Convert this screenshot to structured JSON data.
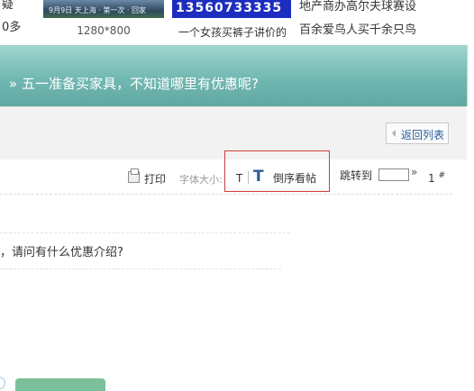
{
  "top": {
    "left_lines": [
      "疑",
      "0多"
    ],
    "thumb1": {
      "caption_overlay": "9月9日 天上海 · 第一次 · 回家",
      "caption": "1280*800"
    },
    "thumb2": {
      "number": "13560733335",
      "caption": "一个女孩买裤子讲价的"
    },
    "news": [
      "地产商办高尔夫球赛设",
      "百余爱鸟人买千余只鸟"
    ]
  },
  "thread": {
    "title": "» 五一准备买家具，不知道哪里有优惠呢?"
  },
  "actions": {
    "back_to_list": "返回列表"
  },
  "toolbar": {
    "print": "打印",
    "font_size_label": "字体大小:",
    "font_small": "T",
    "font_large": "T",
    "reverse_view": "倒序看帖",
    "jump_to": "跳转到",
    "jump_go": "»",
    "floor": "1",
    "floor_suffix": "#"
  },
  "post": {
    "text": "，请问有什么优惠介绍?"
  },
  "colors": {
    "banner": "#72b8b2",
    "link": "#2b5d9c",
    "highlight_box": "#d03a3a"
  }
}
